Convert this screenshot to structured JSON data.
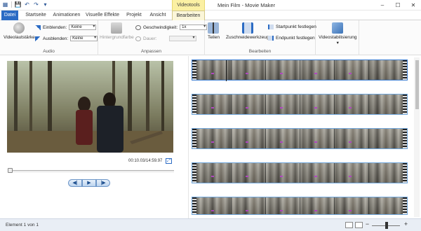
{
  "window": {
    "title": "Mein Film - Movie Maker",
    "contextual_group": "Videotools",
    "controls": [
      "–",
      "☐",
      "✕"
    ]
  },
  "quick_access": {
    "icons": [
      "save-icon",
      "undo-icon",
      "redo-icon",
      "dropdown-icon"
    ]
  },
  "tabs": [
    {
      "label": "Datei"
    },
    {
      "label": "Startseite"
    },
    {
      "label": "Animationen"
    },
    {
      "label": "Visuelle Effekte"
    },
    {
      "label": "Projekt"
    },
    {
      "label": "Ansicht"
    },
    {
      "label": "Bearbeiten"
    }
  ],
  "ribbon": {
    "audio": {
      "group_label": "Audio",
      "volume_label": "Videolautstärke",
      "fade_in_label": "Einblenden:",
      "fade_in_value": "Keine",
      "fade_out_label": "Ausblenden:",
      "fade_out_value": "Keine"
    },
    "adjust": {
      "group_label": "Anpassen",
      "bg_color_label": "Hintergrundfarbe",
      "speed_label": "Geschwindigkeit:",
      "speed_value": "1x",
      "duration_label": "Dauer:",
      "duration_value": ""
    },
    "edit": {
      "group_label": "Bearbeiten",
      "split_label": "Teilen",
      "trim_label": "Zuschneidewerkzeug",
      "set_start_label": "Startpunkt festlegen",
      "set_end_label": "Endpunkt festlegen"
    },
    "stabilize": {
      "label": "Videostabilisierung"
    }
  },
  "preview": {
    "timestamp": "00:10.03/14:59.97",
    "position_fraction": 0.01,
    "transport": {
      "prev": "◀|",
      "play": "▶",
      "next": "|▶"
    }
  },
  "storyboard": {
    "clip_count": 6
  },
  "status": {
    "text": "Element 1 von 1",
    "zoom_fraction": 0.5
  }
}
